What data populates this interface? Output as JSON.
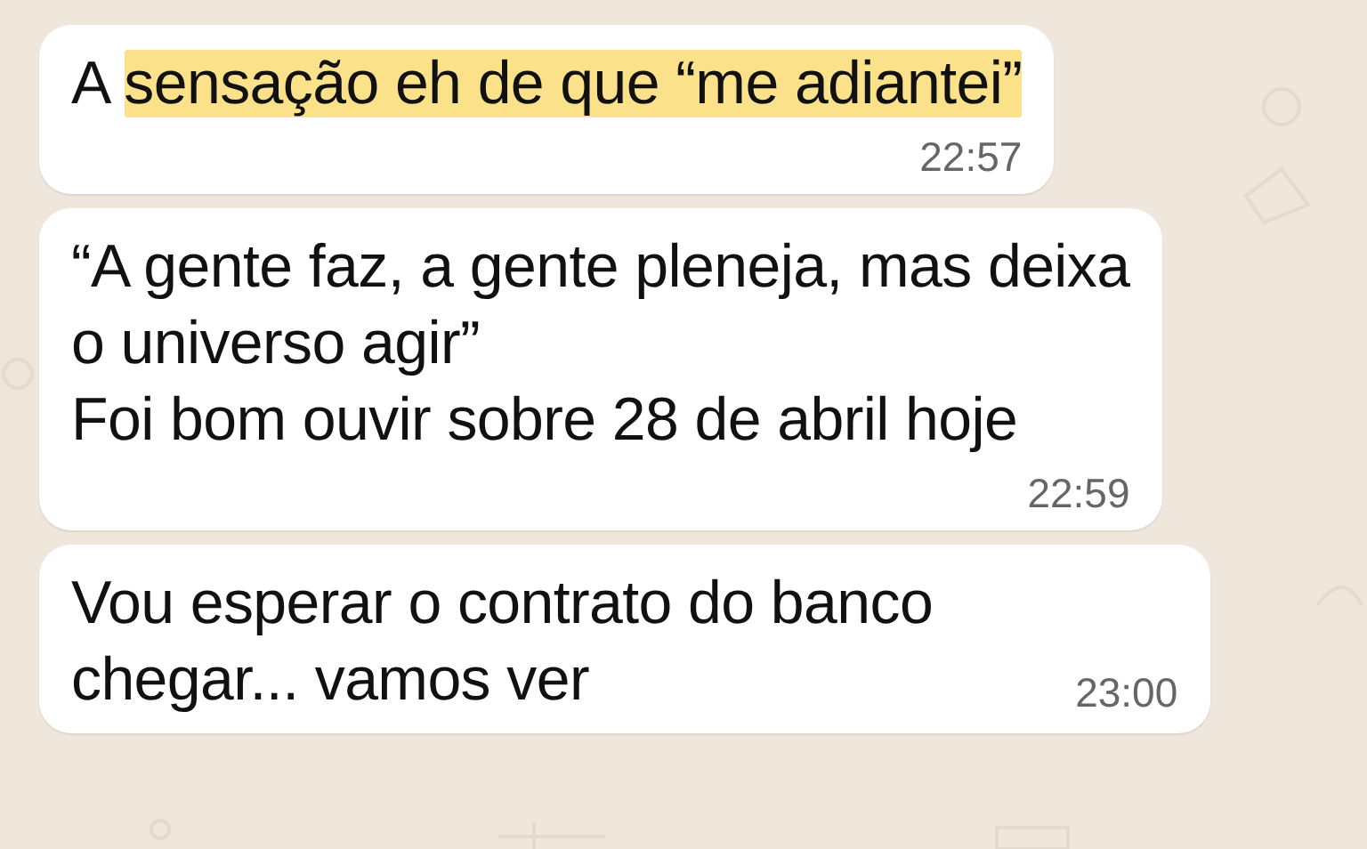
{
  "messages": [
    {
      "segments": [
        {
          "text": "A ",
          "highlighted": false
        },
        {
          "text": "sensação eh de que “me adiantei”",
          "highlighted": true
        }
      ],
      "time": "22:57",
      "kind": "stacked"
    },
    {
      "segments": [
        {
          "text": "“A gente faz, a gente pleneja, mas deixa\no universo agir”\nFoi bom ouvir sobre 28 de abril hoje",
          "highlighted": false
        }
      ],
      "time": "22:59",
      "kind": "stacked"
    },
    {
      "segments": [
        {
          "text": "Vou esperar o contrato do banco\nchegar... vamos ver",
          "highlighted": false
        }
      ],
      "time": "23:00",
      "kind": "inline"
    }
  ]
}
